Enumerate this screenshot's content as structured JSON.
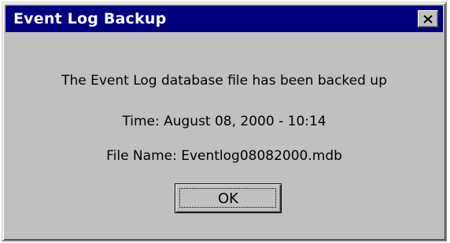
{
  "window": {
    "title": "Event Log Backup",
    "close_icon": "close-icon"
  },
  "body": {
    "message": "The Event Log database file has been backed up",
    "time_line": "Time: August 08, 2000 - 10:14",
    "file_line": "File Name: Eventlog08082000.mdb"
  },
  "buttons": {
    "ok_label": "OK"
  },
  "colors": {
    "titlebar": "#000080",
    "face": "#c0c0c0"
  }
}
